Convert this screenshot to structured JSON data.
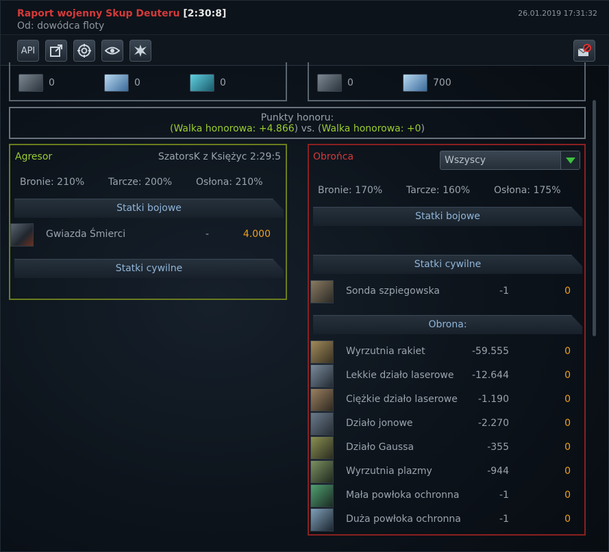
{
  "header": {
    "title_red": "Raport wojenny Skup Deuteru",
    "title_time": "[2:30:8]",
    "subtitle": "Od: dowódca floty",
    "date": "26.01.2019 17:31:32"
  },
  "toolbar": {
    "api_label": "API",
    "buttons": [
      "api",
      "external-link",
      "target",
      "eye",
      "splash"
    ],
    "delete_button": "envelope-delete"
  },
  "summary": {
    "attacker_counts": [
      "0",
      "0",
      "0"
    ],
    "defender_counts": [
      "0",
      "700"
    ]
  },
  "honor": {
    "label": "Punkty honoru:",
    "left_paren": "(",
    "attacker": "Walka honorowa: +4.866",
    "mid": ") vs. (",
    "defender": "Walka honorowa: +0",
    "right_paren": ")"
  },
  "attacker": {
    "role": "Agresor",
    "location": "SzatorsK z Księżyc 2:29:5",
    "weapons": "Bronie: 210%",
    "shields": "Tarcze: 200%",
    "armor": "Osłona: 210%",
    "section_combat": "Statki bojowe",
    "section_civil": "Statki cywilne",
    "ships": [
      {
        "name": "Gwiazda Śmierci",
        "loss": "-",
        "remaining": "4.000"
      }
    ]
  },
  "defender": {
    "role": "Obrońca",
    "filter": "Wszyscy",
    "weapons": "Bronie: 170%",
    "shields": "Tarcze: 160%",
    "armor": "Osłona: 175%",
    "section_combat": "Statki bojowe",
    "section_civil": "Statki cywilne",
    "section_defense": "Obrona:",
    "civil": [
      {
        "name": "Sonda szpiegowska",
        "loss": "-1",
        "remaining": "0"
      }
    ],
    "defense": [
      {
        "name": "Wyrzutnia rakiet",
        "loss": "-59.555",
        "remaining": "0"
      },
      {
        "name": "Lekkie działo laserowe",
        "loss": "-12.644",
        "remaining": "0"
      },
      {
        "name": "Ciężkie działo laserowe",
        "loss": "-1.190",
        "remaining": "0"
      },
      {
        "name": "Działo jonowe",
        "loss": "-2.270",
        "remaining": "0"
      },
      {
        "name": "Działo Gaussa",
        "loss": "-355",
        "remaining": "0"
      },
      {
        "name": "Wyrzutnia plazmy",
        "loss": "-944",
        "remaining": "0"
      },
      {
        "name": "Mała powłoka ochronna",
        "loss": "-1",
        "remaining": "0"
      },
      {
        "name": "Duża powłoka ochronna",
        "loss": "-1",
        "remaining": "0"
      }
    ]
  },
  "colors": {
    "title_red": "#d43a3a",
    "attacker_border": "#6b7d1e",
    "defender_border": "#8b2020",
    "honor_green": "#9acd32",
    "remaining_orange": "#f0a020",
    "section_text": "#8fb4d8"
  }
}
